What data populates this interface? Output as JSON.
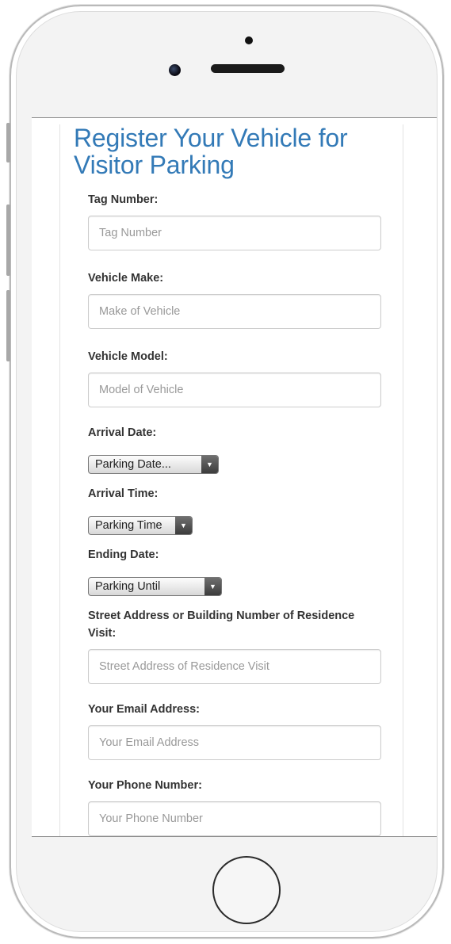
{
  "page": {
    "title": "Register Your Vehicle for Visitor Parking"
  },
  "form": {
    "tag_number": {
      "label": "Tag Number:",
      "placeholder": "Tag Number",
      "value": ""
    },
    "vehicle_make": {
      "label": "Vehicle Make:",
      "placeholder": "Make of Vehicle",
      "value": ""
    },
    "vehicle_model": {
      "label": "Vehicle Model:",
      "placeholder": "Model of Vehicle",
      "value": ""
    },
    "arrival_date": {
      "label": "Arrival Date:",
      "selected": "Parking Date..."
    },
    "arrival_time": {
      "label": "Arrival Time:",
      "selected": "Parking Time"
    },
    "ending_date": {
      "label": "Ending Date:",
      "selected": "Parking Until"
    },
    "street_address": {
      "label": "Street Address or Building Number of Residence Visit:",
      "placeholder": "Street Address of Residence Visit",
      "value": ""
    },
    "email": {
      "label": "Your Email Address:",
      "placeholder": "Your Email Address",
      "value": ""
    },
    "phone": {
      "label": "Your Phone Number:",
      "placeholder": "Your Phone Number",
      "value": ""
    }
  },
  "icons": {
    "select_arrow": "triangle-down-icon",
    "home_button": "home-button",
    "camera": "camera-icon",
    "speaker": "speaker-icon"
  },
  "colors": {
    "title": "#337ab7",
    "label": "#333333",
    "placeholder": "#999999",
    "input_border": "#cccccc"
  }
}
